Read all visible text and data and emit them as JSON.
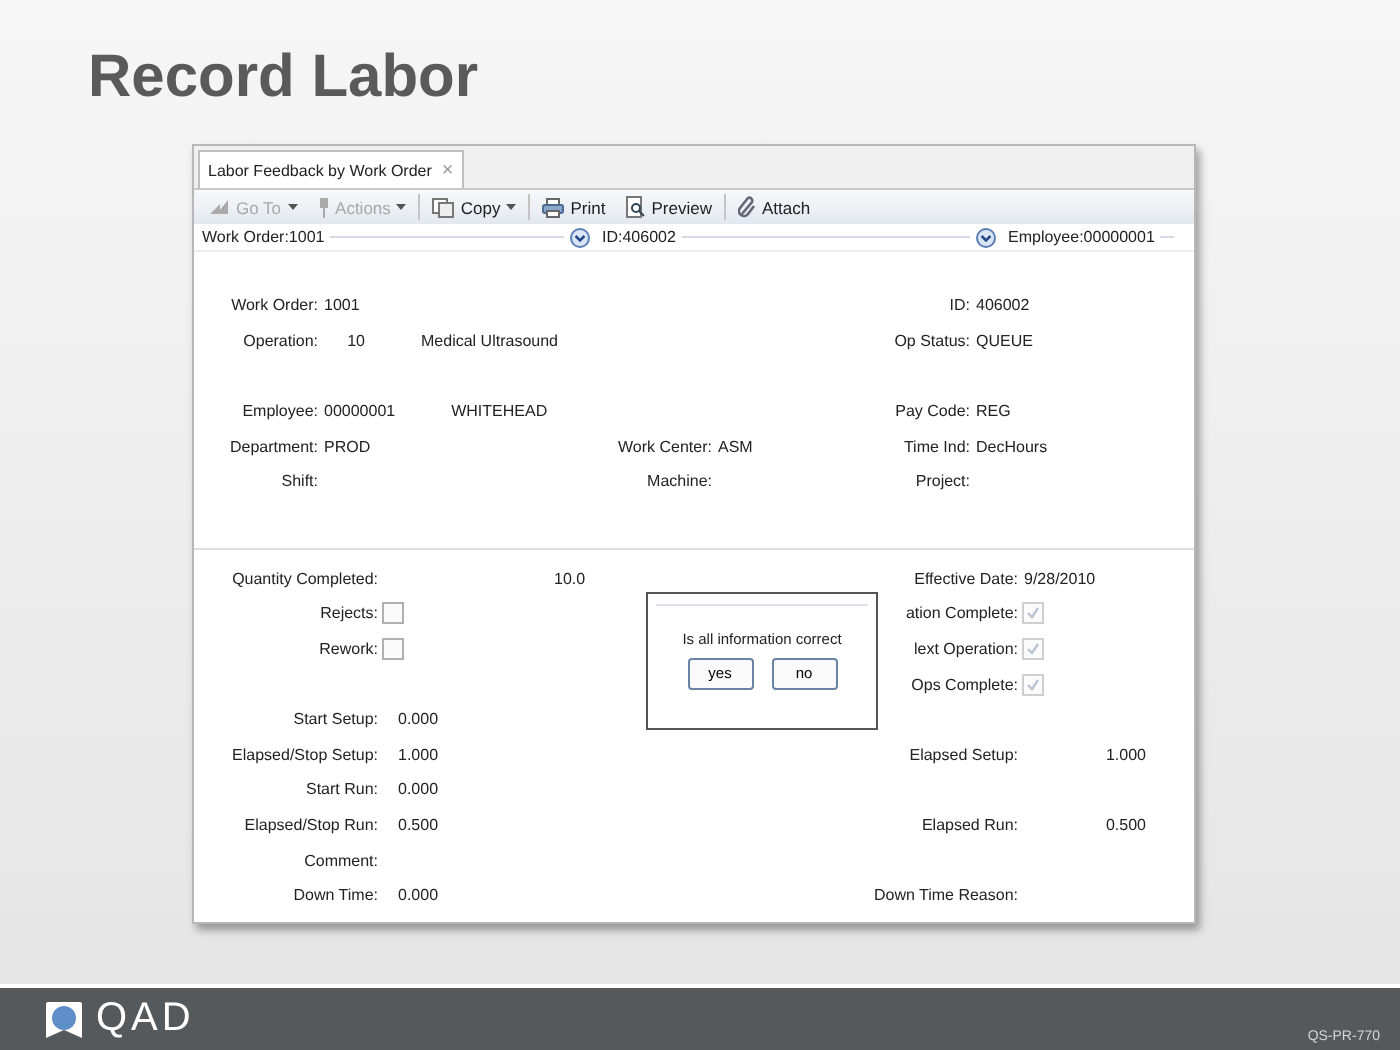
{
  "slide_title": "Record Labor",
  "window": {
    "tab": {
      "label": "Labor Feedback by Work Order",
      "close": "×",
      "selected": true
    },
    "toolbar": [
      {
        "kind": "goto",
        "label": "Go To",
        "disabled": true,
        "menu": true
      },
      {
        "kind": "actions",
        "label": "Actions",
        "disabled": true,
        "menu": true
      },
      {
        "kind": "copy",
        "label": "Copy",
        "disabled": false,
        "menu": true
      },
      {
        "kind": "print",
        "label": "Print",
        "disabled": false,
        "menu": false
      },
      {
        "kind": "preview",
        "label": "Preview",
        "disabled": false,
        "menu": false
      },
      {
        "kind": "attach",
        "label": "Attach",
        "disabled": false,
        "menu": false
      }
    ],
    "key_bar": [
      {
        "label": "Work Order:1001",
        "dropdown": true
      },
      {
        "label": "ID:406002",
        "dropdown": true
      },
      {
        "label": "Employee:00000001",
        "dropdown": false
      }
    ],
    "header_rows": [
      {
        "left": {
          "label": "Work Order:",
          "value": "1001"
        },
        "right": {
          "label": "ID:",
          "value": "406002"
        }
      },
      {
        "left": {
          "label": "Operation:",
          "value": "10",
          "kind": "number",
          "description": "Medical Ultrasound"
        },
        "right": {
          "label": "Op Status:",
          "value": "QUEUE"
        }
      },
      {},
      {
        "left": {
          "label": "Employee:",
          "value": "00000001",
          "description": "WHITEHEAD"
        },
        "right": {
          "label": "Pay Code:",
          "value": "REG"
        }
      },
      {
        "left": {
          "label": "Department:",
          "value": "PROD"
        },
        "middle": {
          "label": "Work Center:",
          "value": "ASM"
        },
        "right": {
          "label": "Time Ind:",
          "value": "DecHours"
        }
      },
      {
        "left": {
          "label": "Shift:"
        },
        "middle": {
          "label": "Machine:"
        },
        "right": {
          "label": "Project:"
        }
      }
    ],
    "detail_rows": [
      {
        "left": {
          "kind": "quantity",
          "label": "Quantity Completed:",
          "value": "10.0"
        },
        "right": {
          "kind": "date",
          "label": "Effective Date:",
          "value": "9/28/2010"
        }
      },
      {
        "left": {
          "kind": "check",
          "label": "Rejects:",
          "checked": false
        },
        "right": {
          "kind": "check",
          "label": "ation Complete:",
          "checked": true
        }
      },
      {
        "left": {
          "kind": "check",
          "label": "Rework:",
          "checked": false
        },
        "right": {
          "kind": "check",
          "label": "lext Operation:",
          "checked": true
        }
      },
      {
        "right": {
          "kind": "check",
          "label": "Ops Complete:",
          "checked": true
        }
      },
      {
        "left": {
          "kind": "number",
          "label": "Start Setup:",
          "value": "0.000"
        }
      },
      {
        "left": {
          "kind": "number",
          "label": "Elapsed/Stop Setup:",
          "value": "1.000"
        },
        "right": {
          "kind": "number",
          "label": "Elapsed Setup:",
          "value": "1.000"
        }
      },
      {
        "left": {
          "kind": "number",
          "label": "Start Run:",
          "value": "0.000"
        }
      },
      {
        "left": {
          "kind": "number",
          "label": "Elapsed/Stop Run:",
          "value": "0.500"
        },
        "right": {
          "kind": "number",
          "label": "Elapsed Run:",
          "value": "0.500"
        }
      },
      {
        "left": {
          "kind": "number",
          "label": "Comment:"
        }
      },
      {
        "left": {
          "kind": "number",
          "label": "Down Time:",
          "value": "0.000"
        },
        "right": {
          "kind": "number",
          "label": "Down Time Reason:"
        }
      }
    ],
    "dialog": {
      "message": "Is all information correct",
      "buttons": [
        "yes",
        "no"
      ]
    }
  },
  "footer": {
    "logo": "QAD",
    "code": "QS-PR-770"
  }
}
